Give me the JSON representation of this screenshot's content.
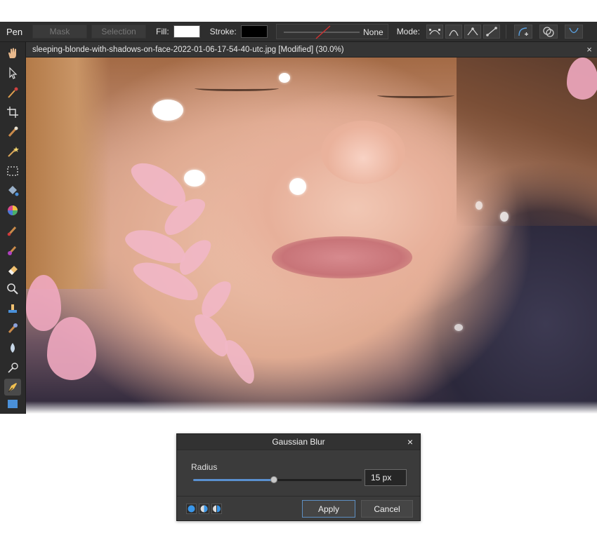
{
  "toolbar": {
    "tool_name": "Pen",
    "mask_label": "Mask",
    "selection_label": "Selection",
    "fill_label": "Fill:",
    "stroke_label": "Stroke:",
    "stroke_style_label": "None",
    "mode_label": "Mode:",
    "fill_color": "#ffffff",
    "stroke_color": "#000000"
  },
  "tools": [
    {
      "name": "hand-icon"
    },
    {
      "name": "pointer-icon"
    },
    {
      "name": "eyedropper-icon"
    },
    {
      "name": "crop-icon"
    },
    {
      "name": "selection-brush-icon"
    },
    {
      "name": "magic-wand-icon"
    },
    {
      "name": "marquee-icon"
    },
    {
      "name": "flood-fill-icon"
    },
    {
      "name": "color-wheel-icon"
    },
    {
      "name": "paint-brush-icon"
    },
    {
      "name": "color-replace-icon"
    },
    {
      "name": "eraser-icon"
    },
    {
      "name": "zoom-icon"
    },
    {
      "name": "clone-stamp-icon"
    },
    {
      "name": "healing-brush-icon"
    },
    {
      "name": "blur-brush-icon"
    },
    {
      "name": "dodge-icon"
    },
    {
      "name": "pen-tool-icon"
    }
  ],
  "document": {
    "tab_title": "sleeping-blonde-with-shadows-on-face-2022-01-06-17-54-40-utc.jpg [Modified] (30.0%)",
    "close_glyph": "×"
  },
  "dialog": {
    "title": "Gaussian Blur",
    "close_glyph": "×",
    "radius_label": "Radius",
    "radius_value": "15 px",
    "slider_fraction": 0.48,
    "apply_label": "Apply",
    "cancel_label": "Cancel",
    "accent_color": "#5a90d0"
  }
}
